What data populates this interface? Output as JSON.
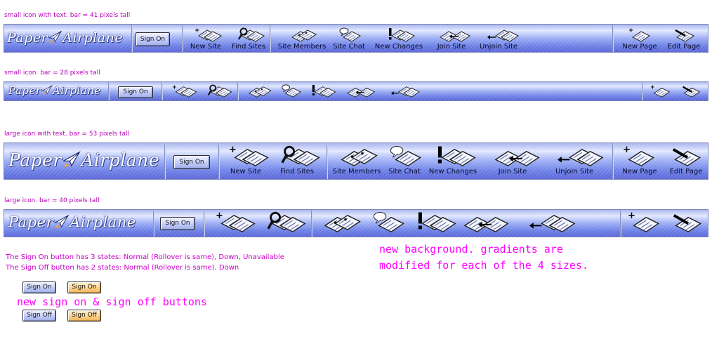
{
  "captions": {
    "bar1": "small icon with text. bar = 41 pixels tall",
    "bar2": "small icon. bar = 28 pixels tall",
    "bar3": "large icon with text. bar = 53 pixels tall",
    "bar4": "large icon. bar = 40 pixels tall"
  },
  "logo_text": {
    "left": "Paper",
    "right": "Airplane"
  },
  "sign_on_label": "Sign On",
  "toolbar_labels": {
    "new_site": "New Site",
    "find_sites": "Find Sites",
    "site_members": "Site Members",
    "site_chat": "Site Chat",
    "new_changes": "New Changes",
    "join_site": "Join Site",
    "unjoin_site": "Unjoin Site",
    "new_page": "New Page",
    "edit_page": "Edit Page"
  },
  "icon_names": {
    "new_site": "new-site-icon",
    "find_sites": "find-sites-icon",
    "site_members": "site-members-icon",
    "site_chat": "site-chat-icon",
    "new_changes": "new-changes-icon",
    "join_site": "join-site-icon",
    "unjoin_site": "unjoin-site-icon",
    "new_page": "new-page-icon",
    "edit_page": "edit-page-icon"
  },
  "notes": {
    "sign_on_states": "The Sign On button has 3 states: Normal (Rollover is same), Down, Unavailable",
    "sign_off_states": "The Sign Off button has 2 states: Normal (Rollover is same), Down",
    "background_note_line1": "new background. gradients are",
    "background_note_line2": "modified for each of the 4 sizes.",
    "buttons_note": "new sign on & sign off buttons"
  },
  "sample_buttons": {
    "sign_on_normal": "Sign On",
    "sign_on_down": "Sign On",
    "sign_off_normal": "Sign Off",
    "sign_off_down": "Sign Off"
  },
  "colors": {
    "caption": "#b800b8",
    "annotation": "#ff00ff",
    "bar_dark": "#5b63d8",
    "bar_light": "#e2e8ff",
    "button_normal": "#c4cdfa",
    "button_down": "#ffd38a"
  }
}
